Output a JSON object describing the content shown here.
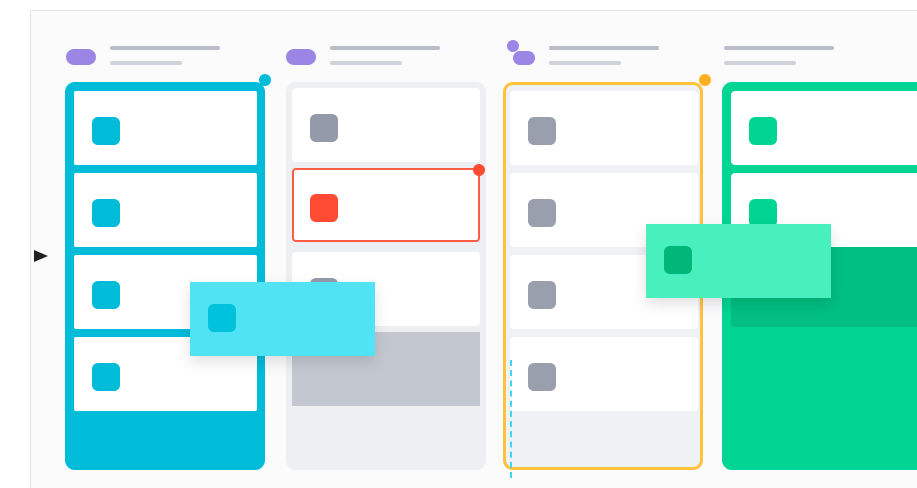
{
  "board": {
    "columns": [
      {
        "id": "col-1",
        "theme": "cyan",
        "accent": "#00bcd9",
        "cards": 4,
        "selected": true
      },
      {
        "id": "col-2",
        "theme": "gray",
        "accent": "#959aab",
        "cards": 4,
        "highlighted_card": 2,
        "highlight_color": "#ff4b34"
      },
      {
        "id": "col-3",
        "theme": "outlined",
        "accent": "#ffc23d",
        "cards": 4,
        "selected": true
      },
      {
        "id": "col-4",
        "theme": "green",
        "accent": "#00d593",
        "cards": 2,
        "selected": true
      }
    ],
    "avatar_color": "#9b86e6",
    "dragging": [
      {
        "column_from": "col-1",
        "color": "#4fe3f4"
      },
      {
        "column_from": "col-4",
        "color": "#47f0bd"
      }
    ]
  },
  "icons": {
    "cursor": "pointer-arrow-icon",
    "avatar": "avatar-icon",
    "handle": "selection-handle-icon"
  }
}
